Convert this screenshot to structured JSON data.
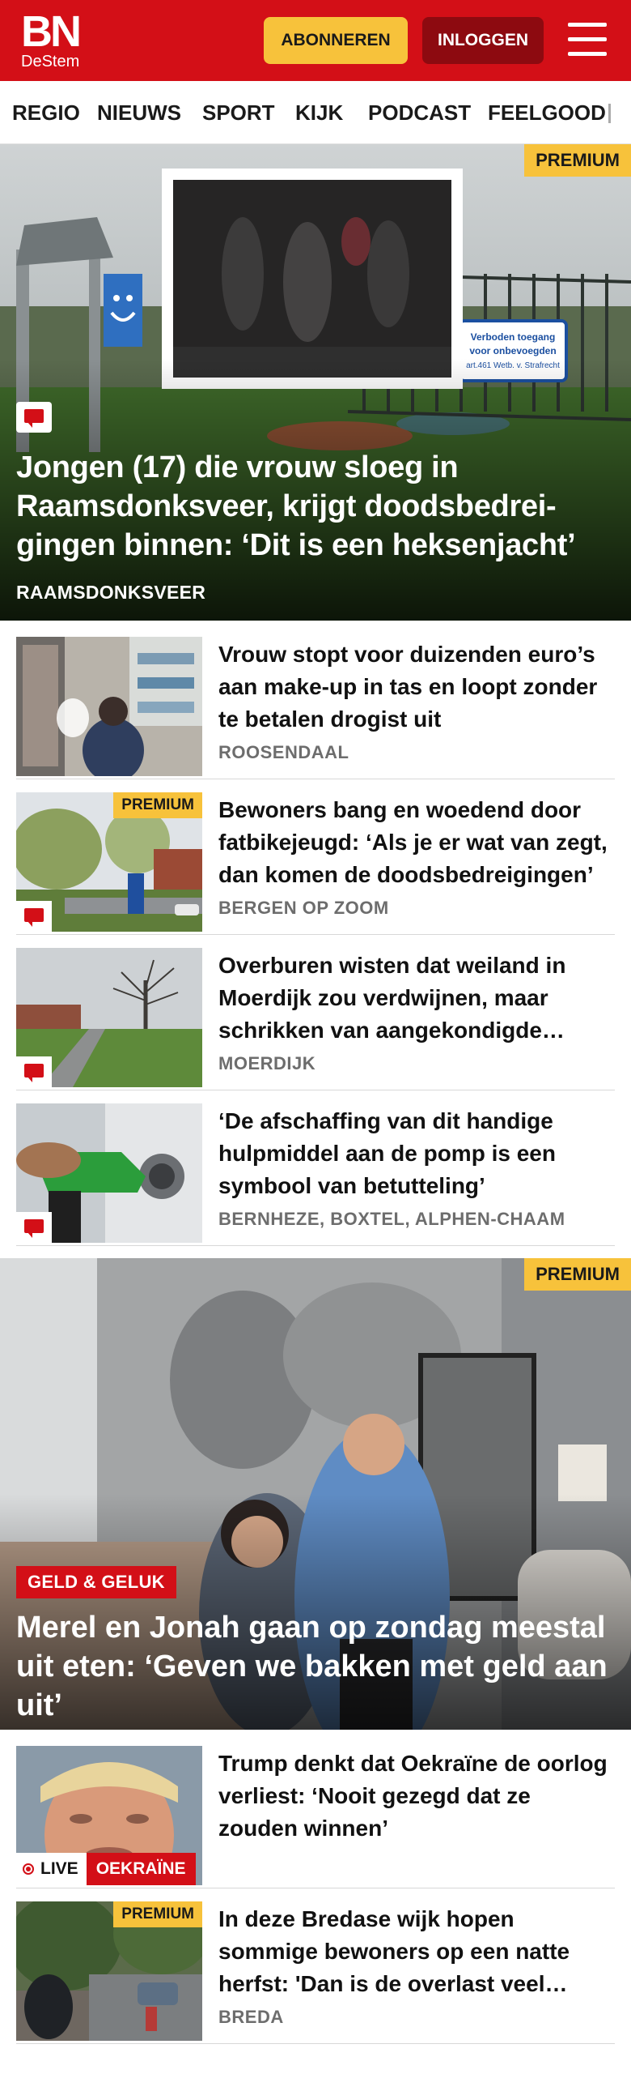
{
  "header": {
    "logo_main": "BN",
    "logo_sub": "DeStem",
    "subscribe_label": "ABONNEREN",
    "login_label": "INLOGGEN",
    "menu_icon": "hamburger-menu-icon",
    "brand_color": "#d30f17",
    "accent_color": "#f7c23b"
  },
  "nav": {
    "items": [
      "REGIO",
      "NIEUWS",
      "SPORT",
      "KIJK",
      "PODCAST",
      "FEELGOOD"
    ]
  },
  "hero": {
    "badge": "PREMIUM",
    "title": "Jongen (17) die vrouw sloeg in Raamsdonksveer, krijgt doodsbedrei­gingen binnen: ‘Dit is een heksenjacht’",
    "tag": "RAAMSDONKSVEER",
    "sign_text": "Verboden toegang voor onbevoegden art.461 Wetb. v. Strafrecht",
    "has_comments": true
  },
  "articles": [
    {
      "title": "Vrouw stopt voor duizenden euro’s aan make-up in tas en loopt zonder te betalen drogist uit",
      "tag": "ROOSENDAAL",
      "premium": false,
      "comments": false
    },
    {
      "title": "Bewoners bang en woedend door fatbikejeugd: ‘Als je er wat van zegt, dan komen de doodsbedreigingen’",
      "tag": "BERGEN OP ZOOM",
      "premium": true,
      "premium_label": "PREMIUM",
      "comments": true
    },
    {
      "title": "Overburen wisten dat weiland in Moerdijk zou verdwijnen, maar schrikken van aangekondigde plannen",
      "tag": "MOERDIJK",
      "premium": false,
      "comments": true
    },
    {
      "title": "‘De afschaffing van dit handige hulpmiddel aan de pomp is een symbool van betutteling’",
      "tag": "BERNHEZE, BOXTEL, ALPHEN-CHAAM",
      "premium": false,
      "comments": true
    }
  ],
  "feature": {
    "badge": "PREMIUM",
    "category": "GELD & GELUK",
    "title": "Merel en Jonah gaan op zondag meestal uit eten: ‘Geven we bakken met geld aan uit’"
  },
  "articles2": [
    {
      "title": "Trump denkt dat Oekraïne de oorlog verliest: ‘Nooit gezegd dat ze zouden winnen’",
      "live_label": "LIVE",
      "topic": "OEKRAÏNE"
    },
    {
      "title": "In deze Bredase wijk hopen sommige bewoners op een natte herfst: 'Dan is de overlast veel minder'",
      "tag": "BREDA",
      "premium_label": "PREMIUM"
    }
  ]
}
